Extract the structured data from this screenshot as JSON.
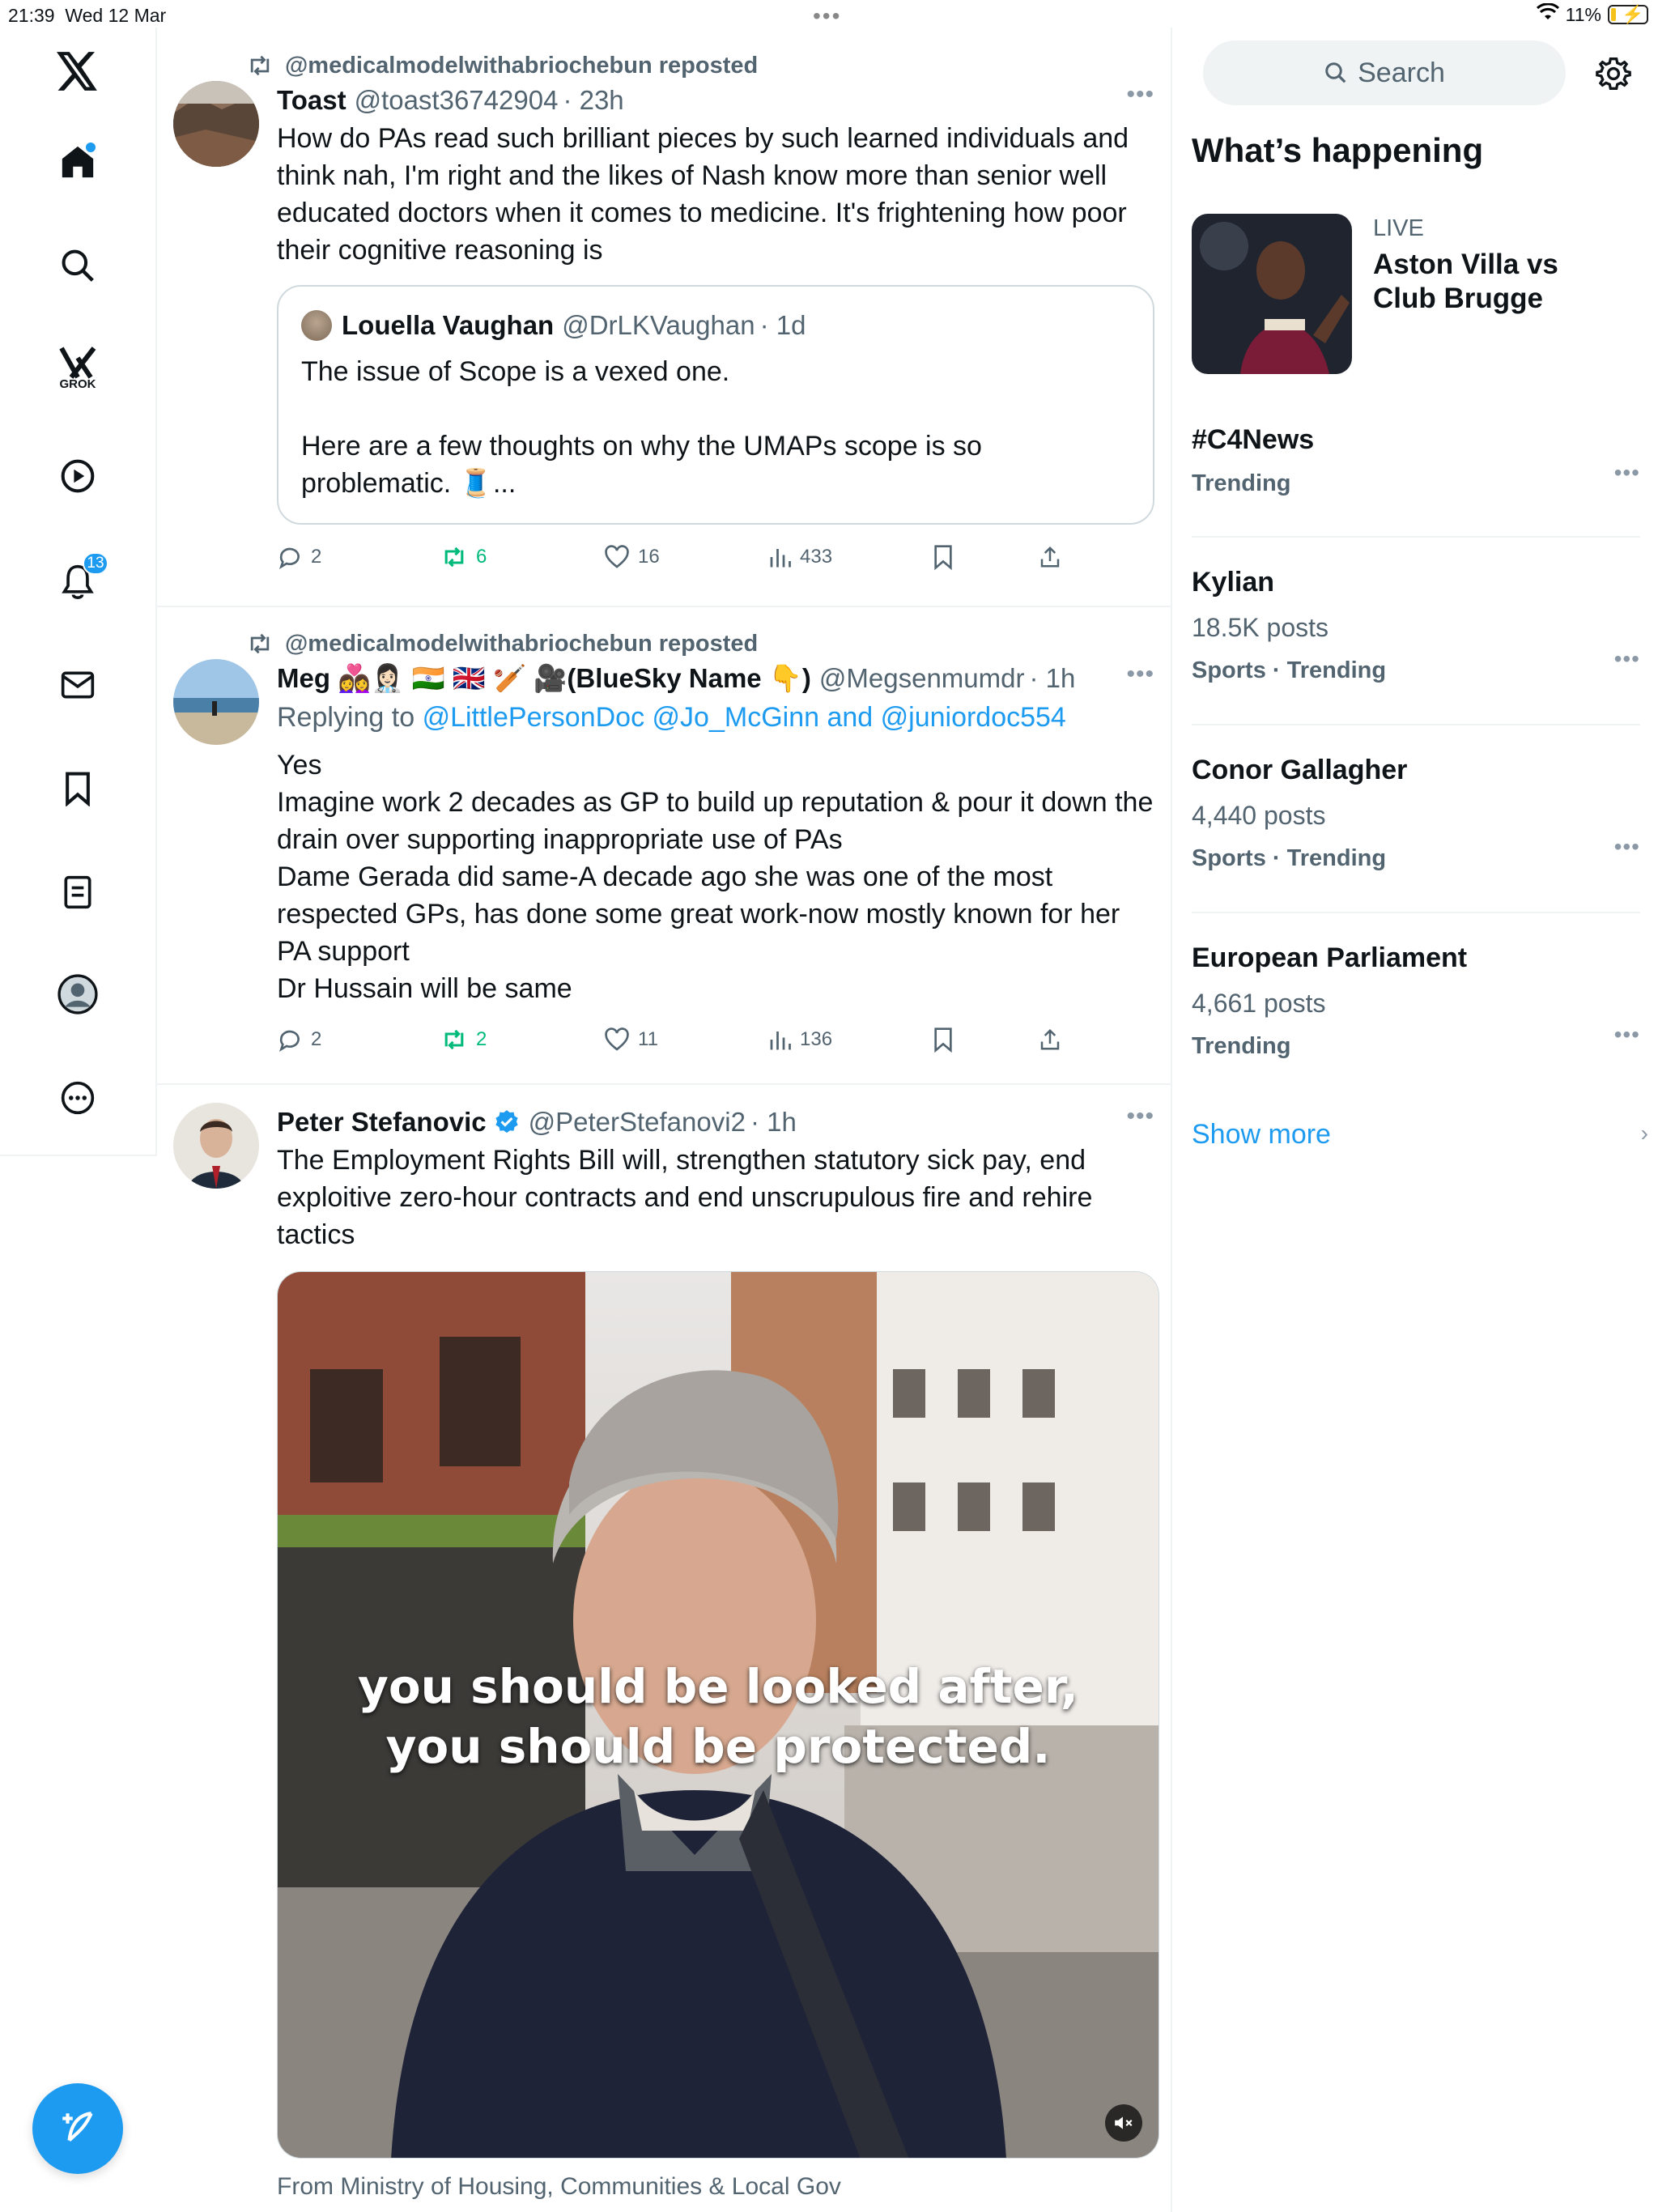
{
  "status_bar": {
    "time": "21:39",
    "date": "Wed 12 Mar",
    "battery": "11%",
    "battery_level": 0.11
  },
  "nav": {
    "grok_label": "GROK",
    "notifications_badge": "13"
  },
  "feed": {
    "posts": [
      {
        "repost_by": "@medicalmodelwithabriochebun reposted",
        "name": "Toast",
        "handle": "@toast36742904",
        "time": "· 23h",
        "text": "How do PAs read such brilliant pieces by such learned individuals and think nah, I'm right and the likes of Nash know more than senior well educated doctors when it comes to medicine. It's frightening how poor their cognitive reasoning is",
        "quote": {
          "name": "Louella Vaughan",
          "handle": "@DrLKVaughan",
          "time": "· 1d",
          "text": "The issue of Scope is a vexed one.\n\nHere are a few thoughts on why the UMAPs scope is so problematic. 🧵..."
        },
        "replies": "2",
        "reposts": "6",
        "likes": "16",
        "views": "433"
      },
      {
        "repost_by": "@medicalmodelwithabriochebun reposted",
        "name": "Meg 👩‍❤️‍👩👩🏻‍⚕️ 🇮🇳 🇬🇧 🏏 🎥(BlueSky Name 👇)",
        "handle": "@Megsenmumdr",
        "time": "· 1h",
        "replying_prefix": "Replying to",
        "replying_to": "@LittlePersonDoc @Jo_McGinn and @juniordoc554",
        "text": "Yes\nImagine work 2 decades as GP to build up reputation & pour it down the drain over supporting inappropriate use of PAs\nDame Gerada did same-A decade ago she was one of the most respected GPs, has done some great work-now mostly known for her PA support\nDr Hussain will be same",
        "replies": "2",
        "reposts": "2",
        "likes": "11",
        "views": "136"
      },
      {
        "name": "Peter Stefanovic",
        "handle": "@PeterStefanovi2",
        "time": "· 1h",
        "text": "The Employment Rights Bill will, strengthen statutory sick pay, end exploitive zero-hour contracts and end unscrupulous fire and rehire tactics",
        "video_caption_1": "you should be looked after,",
        "video_caption_2": "you should be protected.",
        "source": "From Ministry of Housing, Communities & Local Gov"
      }
    ]
  },
  "sidebar": {
    "search_placeholder": "Search",
    "whats_happening": "What’s happening",
    "live": {
      "tag": "LIVE",
      "title": "Aston Villa vs Club Brugge"
    },
    "trends": [
      {
        "title": "#C4News",
        "sub": "",
        "meta": "Trending"
      },
      {
        "title": "Kylian",
        "sub": "18.5K posts",
        "meta": "Sports · Trending"
      },
      {
        "title": "Conor Gallagher",
        "sub": "4,440 posts",
        "meta": "Sports · Trending"
      },
      {
        "title": "European Parliament",
        "sub": "4,661 posts",
        "meta": "Trending"
      }
    ],
    "show_more": "Show more"
  },
  "colors": {
    "accent": "#1d9bf0",
    "repost_green": "#00ba7c",
    "muted_text": "#536471"
  }
}
